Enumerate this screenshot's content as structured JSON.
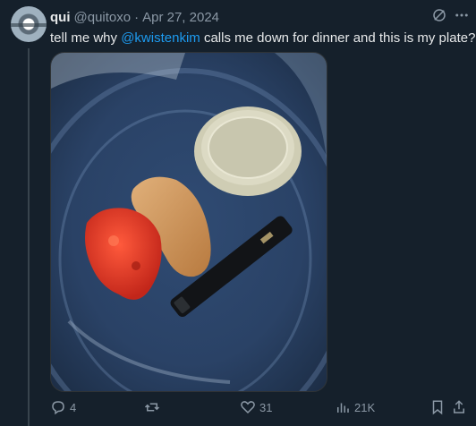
{
  "tweet": {
    "author_name": "qui",
    "handle": "@quitoxo",
    "separator": "·",
    "date": "Apr 27, 2024",
    "text_before": "tell me why ",
    "mention": "@kwistenkim",
    "text_after": " calls me down for dinner and this is my plate?",
    "media_alt": "Clear plastic plate with a chicken tender, red marinara sauce, a sauce cup and a black vape pen"
  },
  "actions": {
    "replies": "4",
    "reposts": "",
    "likes": "31",
    "views": "21K"
  },
  "colors": {
    "background": "#15202b",
    "accent": "#1d9bf0",
    "muted": "#8b98a5",
    "text": "#e7e9ea"
  },
  "icons": [
    "avatar",
    "grok-icon",
    "more-icon",
    "reply-icon",
    "repost-icon",
    "like-icon",
    "views-icon",
    "bookmark-icon",
    "share-icon"
  ]
}
